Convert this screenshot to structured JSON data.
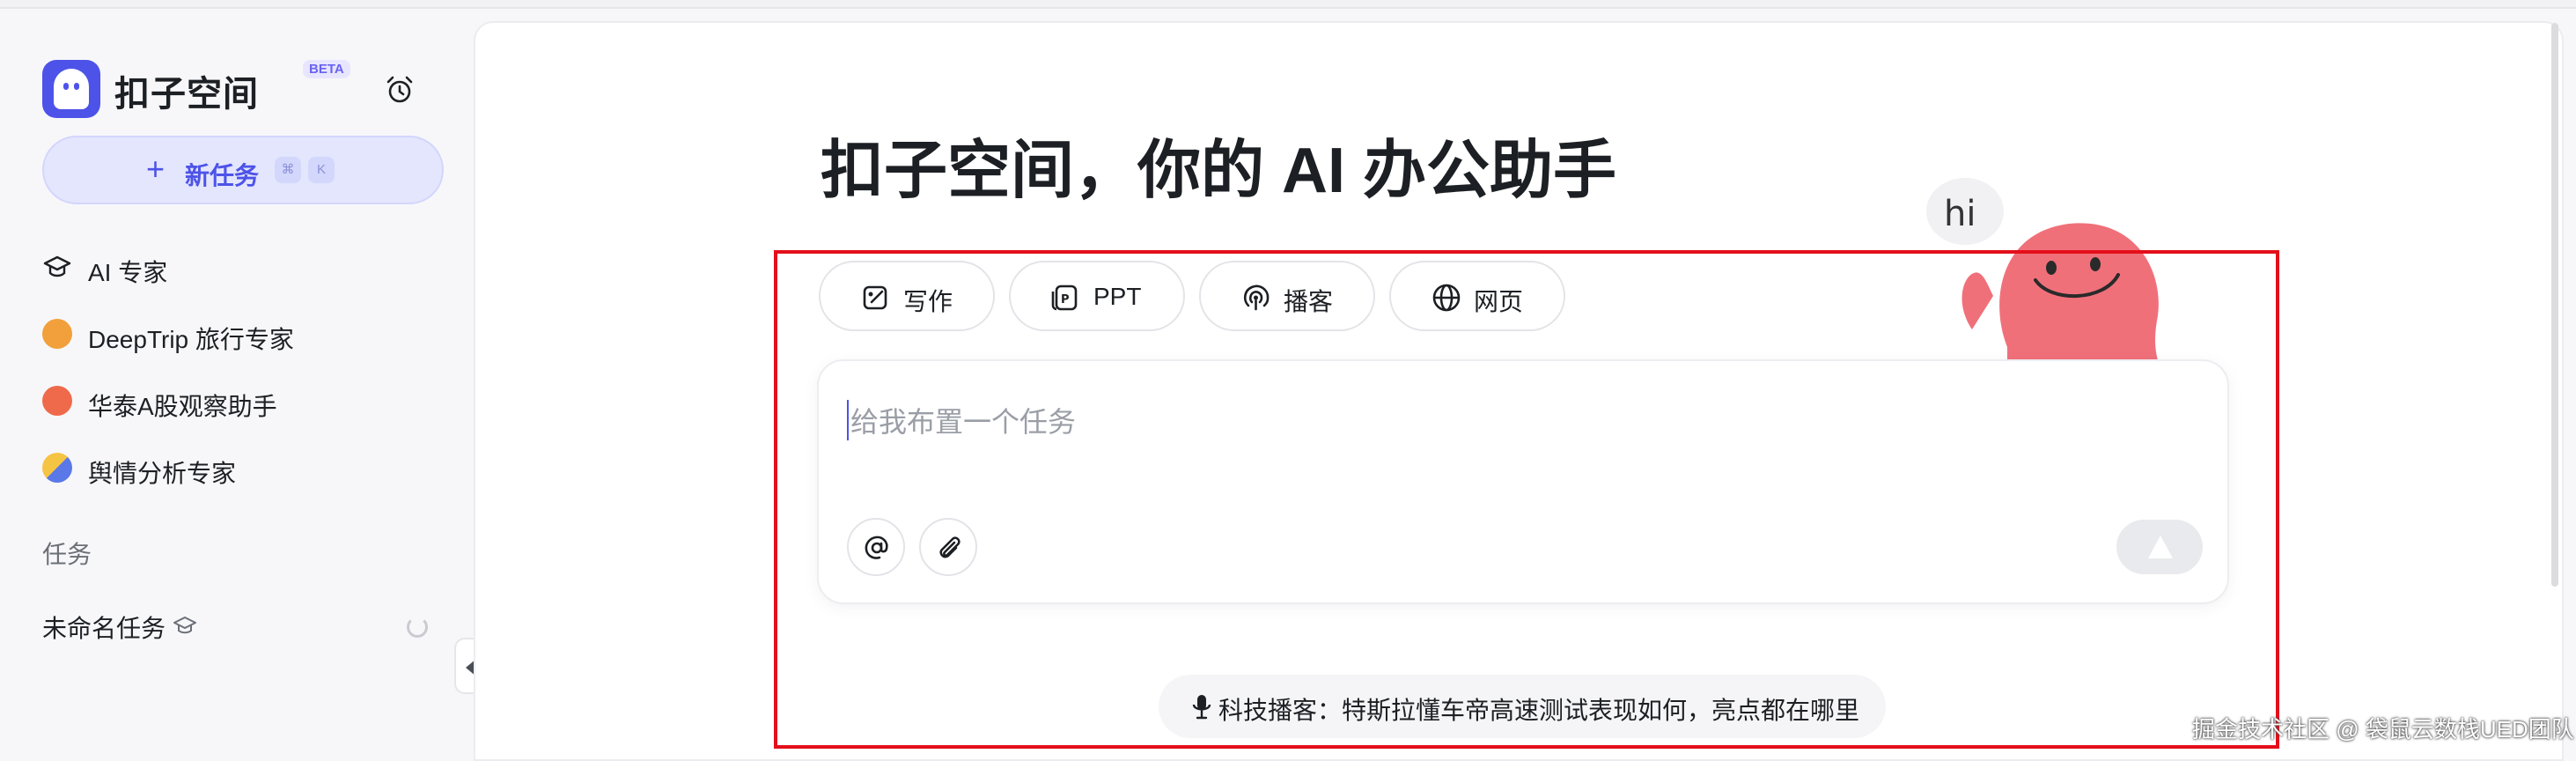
{
  "sidebar": {
    "brand": "扣子空间",
    "beta": "BETA",
    "new_task": {
      "label": "新任务",
      "shortcut_mod": "⌘",
      "shortcut_key": "K"
    },
    "experts": [
      {
        "label": "AI 专家",
        "icon": "graduation-cap-icon"
      },
      {
        "label": "DeepTrip 旅行专家",
        "icon": "deeptrip-avatar-icon"
      },
      {
        "label": "华泰A股观察助手",
        "icon": "huatai-avatar-icon"
      },
      {
        "label": "舆情分析专家",
        "icon": "opinion-avatar-icon"
      }
    ],
    "tasks_section": "任务",
    "tasks": [
      {
        "label": "未命名任务",
        "status": "loading"
      }
    ]
  },
  "main": {
    "headline": "扣子空间，你的 AI 办公助手",
    "chips": [
      {
        "label": "写作",
        "icon": "write-icon"
      },
      {
        "label": "PPT",
        "icon": "ppt-icon"
      },
      {
        "label": "播客",
        "icon": "podcast-icon"
      },
      {
        "label": "网页",
        "icon": "globe-icon"
      }
    ],
    "input": {
      "placeholder": "给我布置一个任务"
    },
    "mascot_text": "hi",
    "suggestion": "科技播客：特斯拉懂车帝高速测试表现如何，亮点都在哪里"
  },
  "watermark": "掘金技术社区 @ 袋鼠云数栈UED团队",
  "colors": {
    "accent": "#4d53e8",
    "highlight_box": "#e30f1a",
    "mascot": "#f0707a"
  }
}
